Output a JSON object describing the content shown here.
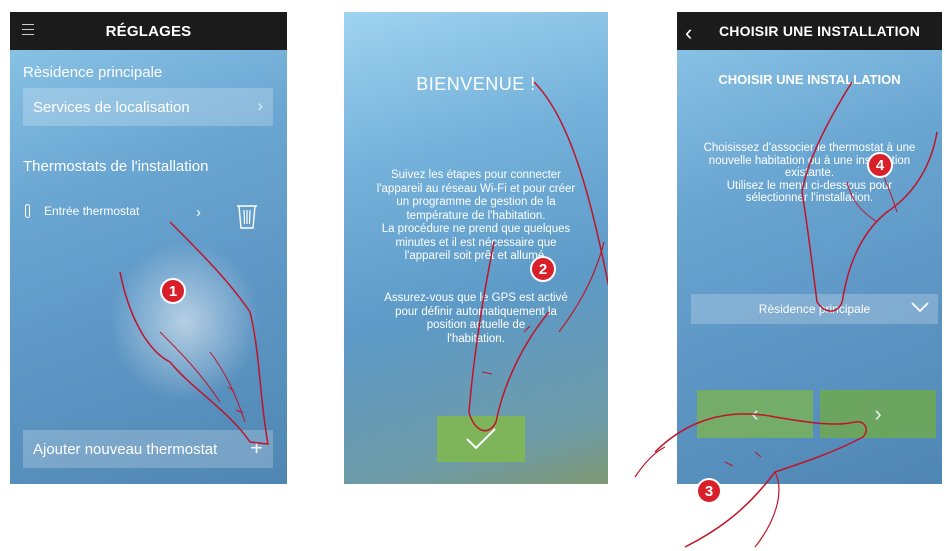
{
  "screen1": {
    "title": "RÉGLAGES",
    "section_residence": "Rèsidence principale",
    "location_services": "Services de localisation",
    "section_thermostats": "Thermostats de l'installation",
    "thermostat_entry": "Entrée thermostat",
    "add_thermostat": "Ajouter nouveau thermostat",
    "step": "1",
    "icons": [
      "menu-icon",
      "chevron-right-icon",
      "thermometer-icon",
      "trash-icon",
      "plus-icon"
    ]
  },
  "screen2": {
    "title": "BIENVENUE !",
    "paragraph1": [
      "Suivez les étapes pour connecter",
      "l'appareil au réseau Wi-Fi et pour créer",
      "un programme de gestion de la",
      "température de l'habitation.",
      "La procédure ne prend que quelques",
      "minutes et il est nécessaire que",
      "l'appareil soit prêt et allumé."
    ],
    "paragraph2": [
      "Assurez-vous que le GPS est activé",
      "pour définir automatiquement la",
      "position actuelle de",
      "l'habitation."
    ],
    "step": "2",
    "icons": [
      "checkmark-icon"
    ]
  },
  "screen3": {
    "header": "CHOISIR UNE INSTALLATION",
    "title": "CHOISIR UNE INSTALLATION",
    "text": [
      "Choisissez d'associer le thermostat à une",
      "nouvelle habitation ou à une installation",
      "existante.",
      "Utilisez le menu ci-dessous pour",
      "sélectionner l'installation."
    ],
    "selected_installation": "Rèsidence principale",
    "prev_label": "‹",
    "next_label": "›",
    "step_select": "4",
    "step_next": "3",
    "icons": [
      "back-chevron-icon",
      "chevron-down-icon"
    ]
  },
  "colors": {
    "topbar": "#1b1b1b",
    "accent_green": "#7eb55a",
    "badge_red": "#d9202a"
  }
}
